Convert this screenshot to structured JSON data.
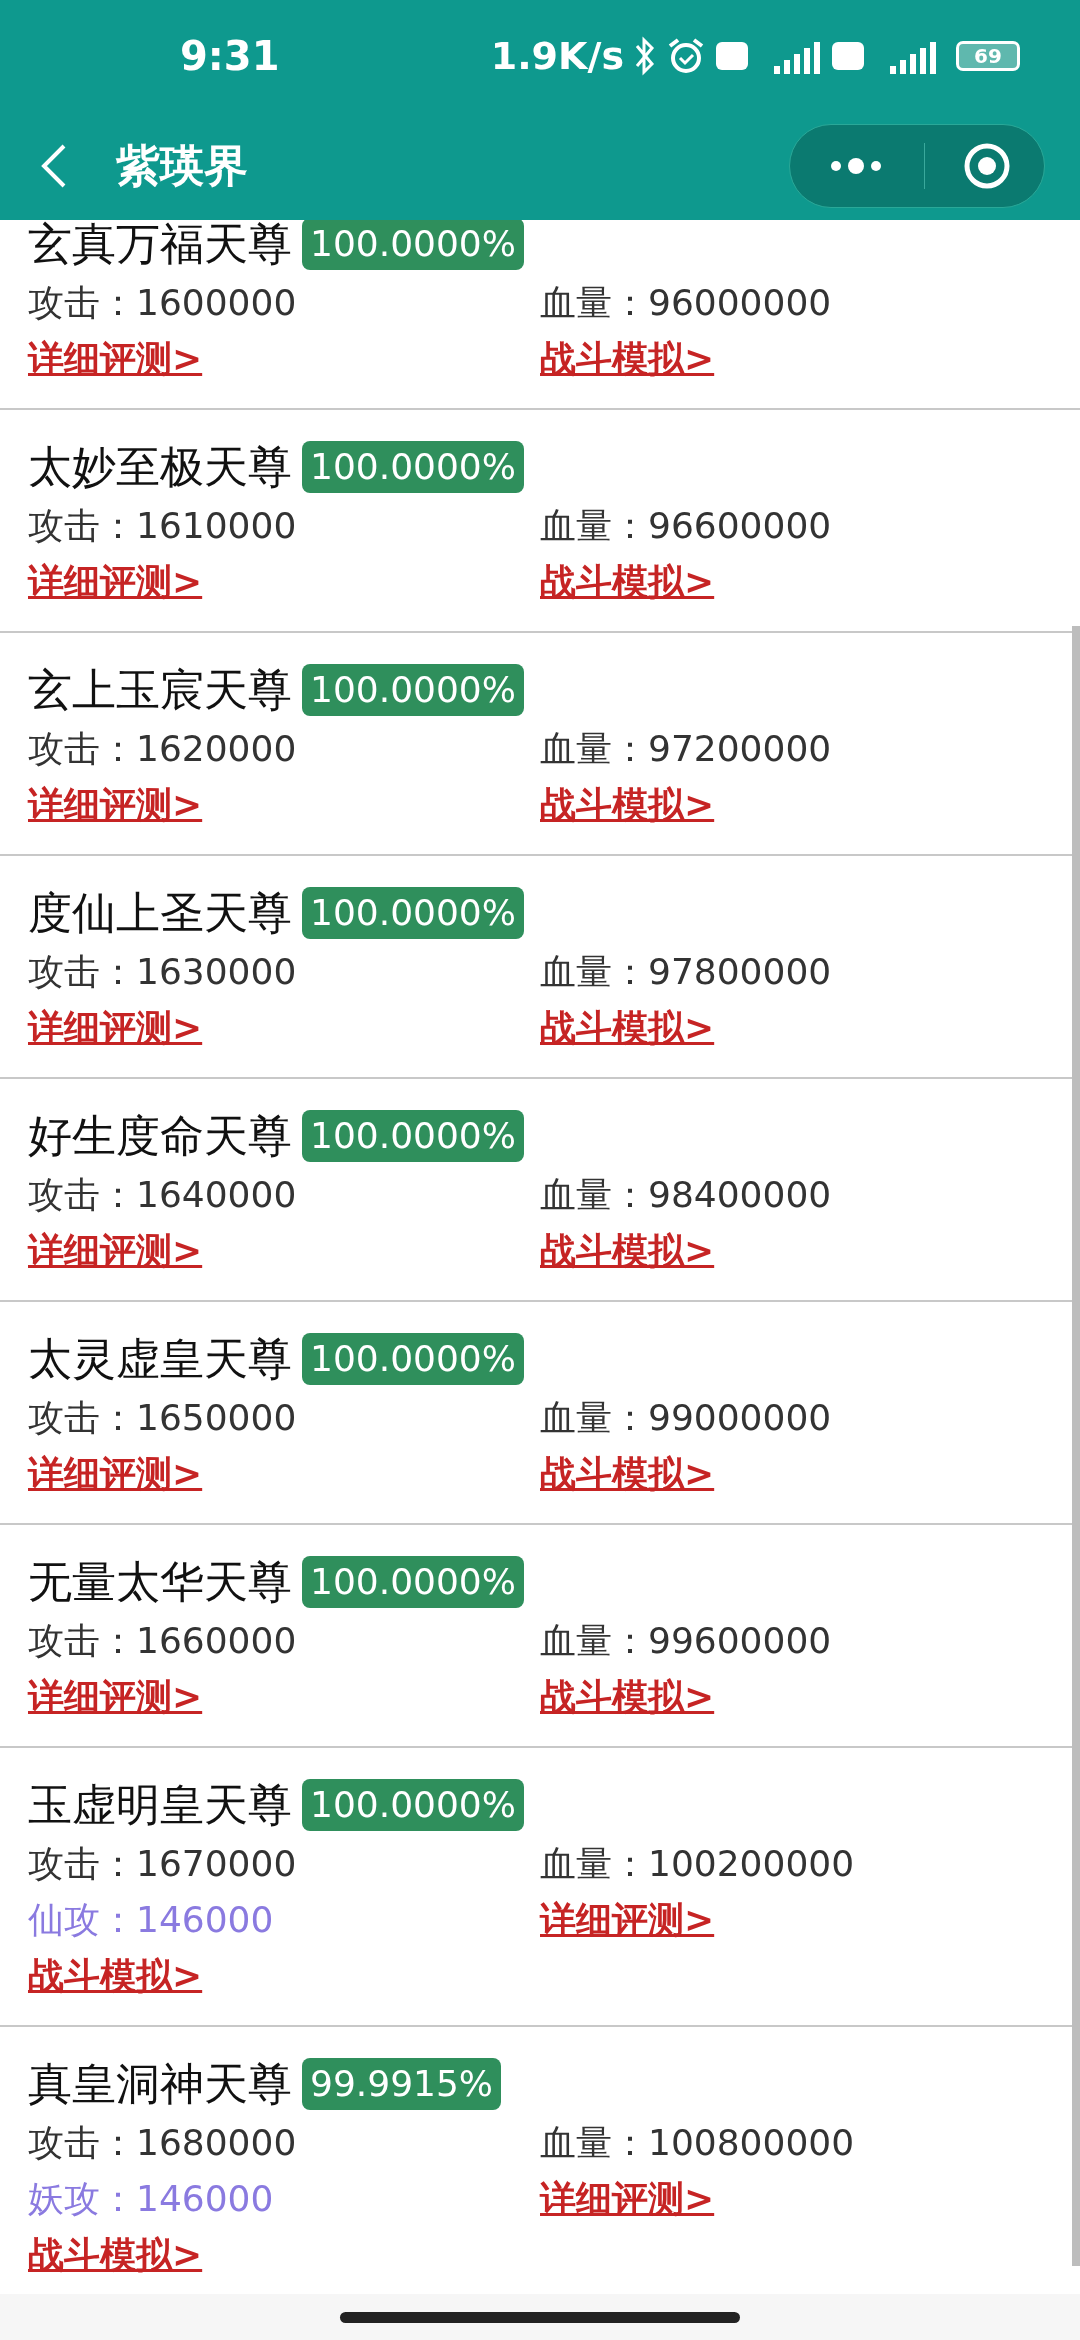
{
  "status_bar": {
    "time": "9:31",
    "speed": "1.9K/s",
    "battery": "69"
  },
  "nav": {
    "title": "紫瑛界"
  },
  "cards": [
    {
      "name": "玄真万福天尊",
      "percent": "100.0000%",
      "fields": [
        {
          "kind": "stat",
          "label": "攻击：",
          "value": "1600000"
        },
        {
          "kind": "stat",
          "label": "血量：",
          "value": "96000000"
        },
        {
          "kind": "link",
          "text": "详细评测>"
        },
        {
          "kind": "link",
          "text": "战斗模拟>"
        }
      ]
    },
    {
      "name": "太妙至极天尊",
      "percent": "100.0000%",
      "fields": [
        {
          "kind": "stat",
          "label": "攻击：",
          "value": "1610000"
        },
        {
          "kind": "stat",
          "label": "血量：",
          "value": "96600000"
        },
        {
          "kind": "link",
          "text": "详细评测>"
        },
        {
          "kind": "link",
          "text": "战斗模拟>"
        }
      ]
    },
    {
      "name": "玄上玉宸天尊",
      "percent": "100.0000%",
      "fields": [
        {
          "kind": "stat",
          "label": "攻击：",
          "value": "1620000"
        },
        {
          "kind": "stat",
          "label": "血量：",
          "value": "97200000"
        },
        {
          "kind": "link",
          "text": "详细评测>"
        },
        {
          "kind": "link",
          "text": "战斗模拟>"
        }
      ]
    },
    {
      "name": "度仙上圣天尊",
      "percent": "100.0000%",
      "fields": [
        {
          "kind": "stat",
          "label": "攻击：",
          "value": "1630000"
        },
        {
          "kind": "stat",
          "label": "血量：",
          "value": "97800000"
        },
        {
          "kind": "link",
          "text": "详细评测>"
        },
        {
          "kind": "link",
          "text": "战斗模拟>"
        }
      ]
    },
    {
      "name": "好生度命天尊",
      "percent": "100.0000%",
      "fields": [
        {
          "kind": "stat",
          "label": "攻击：",
          "value": "1640000"
        },
        {
          "kind": "stat",
          "label": "血量：",
          "value": "98400000"
        },
        {
          "kind": "link",
          "text": "详细评测>"
        },
        {
          "kind": "link",
          "text": "战斗模拟>"
        }
      ]
    },
    {
      "name": "太灵虚皇天尊",
      "percent": "100.0000%",
      "fields": [
        {
          "kind": "stat",
          "label": "攻击：",
          "value": "1650000"
        },
        {
          "kind": "stat",
          "label": "血量：",
          "value": "99000000"
        },
        {
          "kind": "link",
          "text": "详细评测>"
        },
        {
          "kind": "link",
          "text": "战斗模拟>"
        }
      ]
    },
    {
      "name": "无量太华天尊",
      "percent": "100.0000%",
      "fields": [
        {
          "kind": "stat",
          "label": "攻击：",
          "value": "1660000"
        },
        {
          "kind": "stat",
          "label": "血量：",
          "value": "99600000"
        },
        {
          "kind": "link",
          "text": "详细评测>"
        },
        {
          "kind": "link",
          "text": "战斗模拟>"
        }
      ]
    },
    {
      "name": "玉虚明皇天尊",
      "percent": "100.0000%",
      "fields": [
        {
          "kind": "stat",
          "label": "攻击：",
          "value": "1670000"
        },
        {
          "kind": "stat",
          "label": "血量：",
          "value": "100200000"
        },
        {
          "kind": "special",
          "label": "仙攻：",
          "value": "146000"
        },
        {
          "kind": "link",
          "text": "详细评测>"
        },
        {
          "kind": "link",
          "text": "战斗模拟>"
        }
      ]
    },
    {
      "name": "真皇洞神天尊",
      "percent": "99.9915%",
      "fields": [
        {
          "kind": "stat",
          "label": "攻击：",
          "value": "1680000"
        },
        {
          "kind": "stat",
          "label": "血量：",
          "value": "100800000"
        },
        {
          "kind": "special",
          "label": "妖攻：",
          "value": "146000"
        },
        {
          "kind": "link",
          "text": "详细评测>"
        },
        {
          "kind": "link",
          "text": "战斗模拟>"
        }
      ]
    }
  ]
}
